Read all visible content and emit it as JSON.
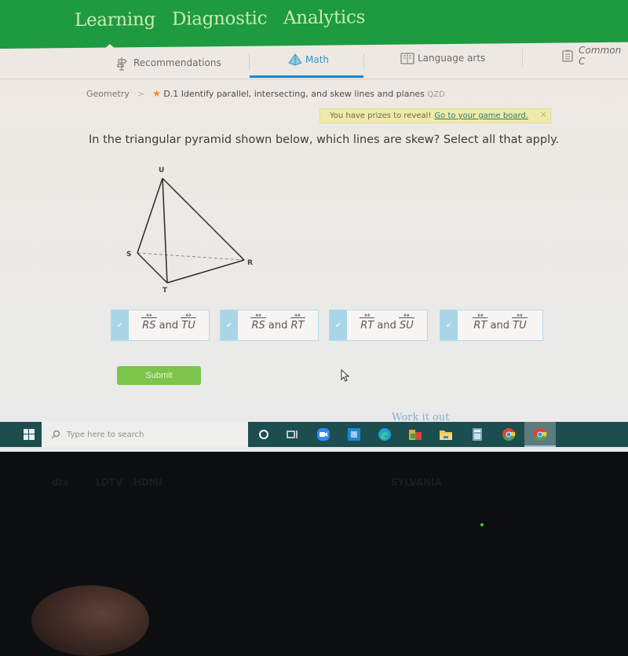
{
  "header": {
    "nav": [
      "Learning",
      "Diagnostic",
      "Analytics"
    ],
    "active_nav": "Learning",
    "brand_color": "#1e9a41"
  },
  "subnav": {
    "tabs": [
      {
        "label": "Recommendations",
        "icon": "signpost-icon"
      },
      {
        "label": "Math",
        "icon": "pyramid-icon",
        "active": true
      },
      {
        "label": "Language arts",
        "icon": "book-icon"
      },
      {
        "label": "Common C",
        "icon": "clipboard-icon"
      }
    ],
    "accent_color": "#1d86c8"
  },
  "breadcrumb": {
    "subject": "Geometry",
    "separator": ">",
    "skill": "D.1 Identify parallel, intersecting, and skew lines and planes",
    "code": "QZD"
  },
  "prize_banner": {
    "text": "You have prizes to reveal!",
    "link": "Go to your game board.",
    "close": "×"
  },
  "question": {
    "prompt": "In the triangular pyramid shown below, which lines are skew? Select all that apply.",
    "figure": {
      "vertices": {
        "U": "U",
        "S": "S",
        "R": "R",
        "T": "T"
      },
      "hidden_edge": "SR"
    },
    "choices": [
      {
        "a": "RS",
        "and": "and",
        "b": "TU"
      },
      {
        "a": "RS",
        "and": "and",
        "b": "RT"
      },
      {
        "a": "RT",
        "and": "and",
        "b": "SU"
      },
      {
        "a": "RT",
        "and": "and",
        "b": "TU"
      }
    ],
    "submit_label": "Submit",
    "work_it_out": "Work it out"
  },
  "taskbar": {
    "search_placeholder": "Type here to search",
    "apps": [
      "cortana-icon",
      "task-view-icon",
      "zoom-icon",
      "store-icon",
      "edge-icon",
      "office-icon",
      "file-explorer-icon",
      "calculator-icon",
      "chrome-icon",
      "chrome-icon"
    ]
  },
  "monitor": {
    "labels": [
      "dts",
      "1OTV",
      "HDMI"
    ],
    "brand": "SYLVANIA"
  }
}
